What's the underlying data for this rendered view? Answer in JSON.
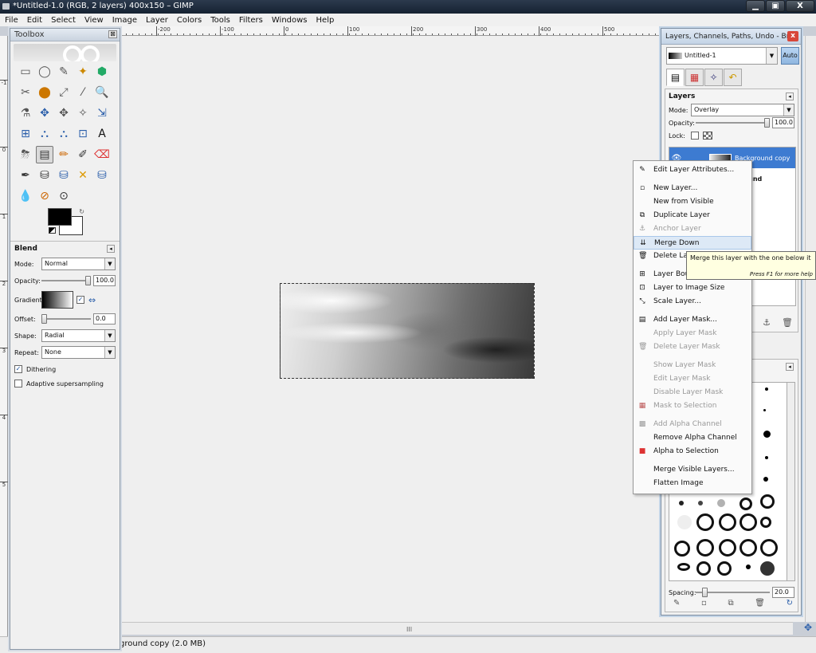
{
  "window": {
    "title": "*Untitled-1.0 (RGB, 2 layers) 400x150 – GIMP",
    "minimize": "▁",
    "maximize": "▣",
    "close": "X"
  },
  "menu": [
    "File",
    "Edit",
    "Select",
    "View",
    "Image",
    "Layer",
    "Colors",
    "Tools",
    "Filters",
    "Windows",
    "Help"
  ],
  "ruler": {
    "h_ticks": [
      "-200",
      "-100",
      "0",
      "100",
      "200",
      "300",
      "400",
      "500"
    ],
    "v_ticks": [
      "-1",
      "0",
      "1",
      "2",
      "3",
      "4",
      "5"
    ]
  },
  "toolbox": {
    "title": "Toolbox",
    "close": "⊠",
    "tools": [
      "▭",
      "◯",
      "✎",
      "✦",
      "⬢",
      "✂",
      "⬤",
      "⤢",
      "⁄",
      "🔍",
      "⚗",
      "✥",
      "✥",
      "✧",
      "⇲",
      "⊞",
      "⛬",
      "⛬",
      "⊡",
      "A",
      "⛈",
      "▤",
      "✏",
      "✐",
      "⌫",
      "✒",
      "⛁",
      "⛁",
      "✕",
      "⛁",
      "💧",
      "⊘",
      "⊙"
    ],
    "blend": {
      "heading": "Blend",
      "mode_label": "Mode:",
      "mode_value": "Normal",
      "opacity_label": "Opacity:",
      "opacity_value": "100.0",
      "gradient_label": "Gradient:",
      "offset_label": "Offset:",
      "offset_value": "0.0",
      "shape_label": "Shape:",
      "shape_value": "Radial",
      "repeat_label": "Repeat:",
      "repeat_value": "None",
      "dithering_label": "Dithering",
      "adaptive_label": "Adaptive supersampling"
    }
  },
  "dock": {
    "title": "Layers, Channels, Paths, Undo - Br...",
    "close": "x",
    "image_select": "Untitled-1",
    "auto": "Auto",
    "layers": {
      "heading": "Layers",
      "mode_label": "Mode:",
      "mode_value": "Overlay",
      "opacity_label": "Opacity:",
      "opacity_value": "100.0",
      "lock_label": "Lock:",
      "rows": [
        {
          "name": "Background copy",
          "selected": true
        },
        {
          "name": "ground",
          "selected": false
        }
      ]
    },
    "brushes": {
      "spacing_label": "Spacing:",
      "spacing_value": "20.0"
    }
  },
  "context_menu": {
    "items": [
      {
        "label": "Edit Layer Attributes...",
        "icon": "✎",
        "disabled": false,
        "highlight": false
      },
      {
        "sep": true
      },
      {
        "label": "New Layer...",
        "icon": "▫",
        "disabled": false,
        "highlight": false
      },
      {
        "label": "New from Visible",
        "icon": "",
        "disabled": false,
        "highlight": false
      },
      {
        "label": "Duplicate Layer",
        "icon": "⧉",
        "disabled": false,
        "highlight": false
      },
      {
        "label": "Anchor Layer",
        "icon": "⚓",
        "disabled": true,
        "highlight": false
      },
      {
        "label": "Merge Down",
        "icon": "⇊",
        "disabled": false,
        "highlight": true
      },
      {
        "label": "Delete Layer",
        "icon": "🗑",
        "disabled": false,
        "highlight": false
      },
      {
        "sep": true
      },
      {
        "label": "Layer Boundary Size...",
        "icon": "⊞",
        "disabled": false,
        "highlight": false
      },
      {
        "label": "Layer to Image Size",
        "icon": "⊡",
        "disabled": false,
        "highlight": false
      },
      {
        "label": "Scale Layer...",
        "icon": "⤡",
        "disabled": false,
        "highlight": false
      },
      {
        "sep": true
      },
      {
        "label": "Add Layer Mask...",
        "icon": "▤",
        "disabled": false,
        "highlight": false
      },
      {
        "label": "Apply Layer Mask",
        "icon": "",
        "disabled": true,
        "highlight": false
      },
      {
        "label": "Delete Layer Mask",
        "icon": "🗑",
        "disabled": true,
        "highlight": false
      },
      {
        "sep": true
      },
      {
        "label": "Show Layer Mask",
        "icon": "",
        "disabled": true,
        "highlight": false
      },
      {
        "label": "Edit Layer Mask",
        "icon": "",
        "disabled": true,
        "highlight": false
      },
      {
        "label": "Disable Layer Mask",
        "icon": "",
        "disabled": true,
        "highlight": false
      },
      {
        "label": "Mask to Selection",
        "icon": "▦",
        "disabled": true,
        "highlight": false
      },
      {
        "sep": true
      },
      {
        "label": "Add Alpha Channel",
        "icon": "▩",
        "disabled": true,
        "highlight": false
      },
      {
        "label": "Remove Alpha Channel",
        "icon": "",
        "disabled": false,
        "highlight": false
      },
      {
        "label": "Alpha to Selection",
        "icon": "■",
        "disabled": false,
        "highlight": false
      },
      {
        "sep": true
      },
      {
        "label": "Merge Visible Layers...",
        "icon": "",
        "disabled": false,
        "highlight": false
      },
      {
        "label": "Flatten Image",
        "icon": "",
        "disabled": false,
        "highlight": false
      }
    ]
  },
  "tooltip": {
    "text": "Merge this layer with the one below it",
    "hint": "Press F1 for more help"
  },
  "status": {
    "text": "ground copy (2.0 MB)",
    "grip": "III"
  },
  "colors": {
    "highlight": "#dde9f6",
    "layer_selected": "#3d7bd1",
    "tooltip_bg": "#ffffe1"
  }
}
